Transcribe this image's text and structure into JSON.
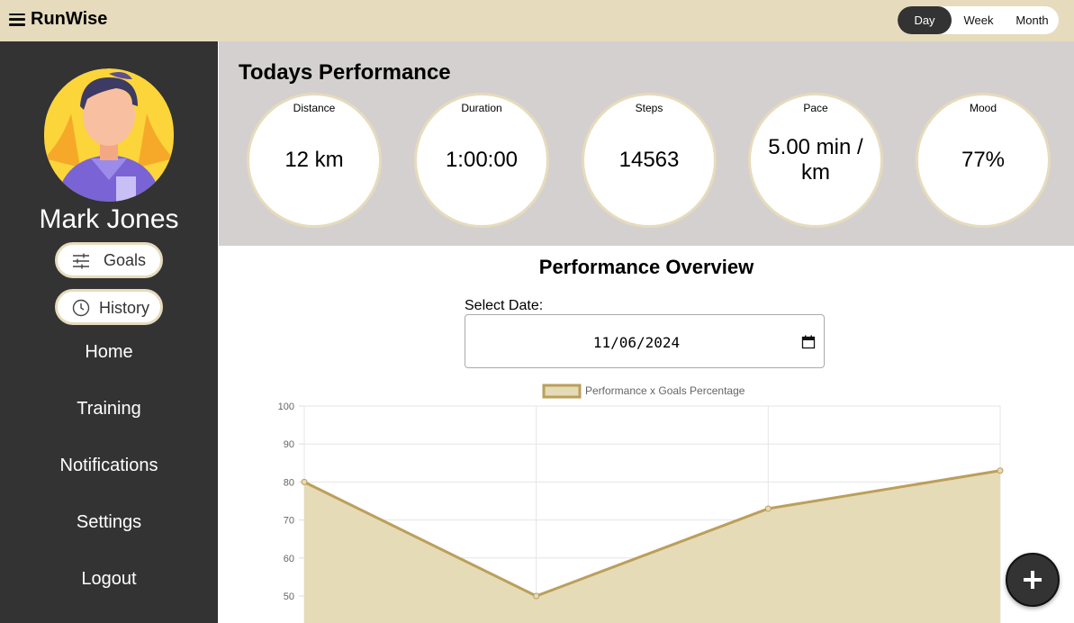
{
  "app": {
    "name": "RunWise"
  },
  "range": {
    "day": "Day",
    "week": "Week",
    "month": "Month",
    "selected": "Day"
  },
  "user": {
    "name": "Mark Jones"
  },
  "sidebar": {
    "goals_label": "Goals",
    "history_label": "History",
    "nav": [
      "Home",
      "Training",
      "Notifications",
      "Settings",
      "Logout"
    ]
  },
  "today": {
    "title": "Todays Performance",
    "metrics": [
      {
        "label": "Distance",
        "value": "12 km"
      },
      {
        "label": "Duration",
        "value": "1:00:00"
      },
      {
        "label": "Steps",
        "value": "14563"
      },
      {
        "label": "Pace",
        "value": "5.00 min / km"
      },
      {
        "label": "Mood",
        "value": "77%"
      }
    ]
  },
  "overview": {
    "title": "Performance Overview",
    "date_label": "Select Date:",
    "date_value": "11/06/2024"
  },
  "chart_data": {
    "type": "area",
    "legend": [
      "Performance x Goals Percentage"
    ],
    "legend_position": "top",
    "x": [
      "",
      "",
      "",
      ""
    ],
    "series": [
      {
        "name": "Performance x Goals Percentage",
        "values": [
          80,
          50,
          73,
          83
        ]
      }
    ],
    "yticks": [
      100,
      90,
      80,
      70,
      60,
      50
    ],
    "ylim": [
      40,
      100
    ],
    "grid": true,
    "colors": {
      "line": "#bb9f5a",
      "fill": "#e6dbb7"
    }
  },
  "colors": {
    "topbar": "#e6dbbd",
    "sidebar": "#333333",
    "panel": "#d4d0cf",
    "accent": "#e6dbbd"
  },
  "icons": {
    "menu": "hamburger-icon",
    "goals": "sliders-icon",
    "history": "clock-icon",
    "add": "plus-icon",
    "date": "calendar-icon"
  }
}
